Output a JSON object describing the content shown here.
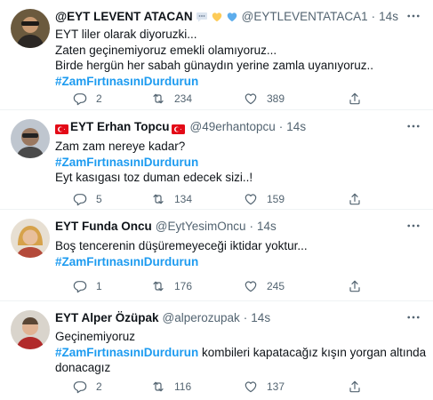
{
  "tweets": [
    {
      "name": "@EYT LEVENT ATACAN",
      "handle": "@EYTLEVENTATACA1",
      "dot": "·",
      "time": "14s",
      "lines": [
        "EYT liler olarak diyoruzki...",
        "Zaten geçinemiyoruz emekli olamıyoruz...",
        "Birde hergün her sabah günaydın yerine zamla uyanıyoruz.."
      ],
      "hashtag": "#ZamFırtınasınıDurdurun",
      "replies": "2",
      "retweets": "234",
      "likes": "389",
      "icons": [
        "speech-bubble-emoji-icon",
        "yellow-heart-emoji-icon",
        "blue-heart-emoji-icon"
      ]
    },
    {
      "name": "EYT Erhan Topcu",
      "handle": "@49erhantopcu",
      "dot": "·",
      "time": "14s",
      "line1": "Zam zam nereye kadar?",
      "hashtag": "#ZamFırtınasınıDurdurun",
      "line2": "Eyt kasıgası toz duman edecek sizi..!",
      "replies": "5",
      "retweets": "134",
      "likes": "159",
      "icons": [
        "turkey-flag-icon",
        "turkey-flag-icon"
      ]
    },
    {
      "name": "EYT Funda Oncu",
      "handle": "@EytYesimOncu",
      "dot": "·",
      "time": "14s",
      "line1": "Boş tencerenin düşüremeyeceği iktidar yoktur...",
      "hashtag": "#ZamFırtınasınıDurdurun",
      "replies": "1",
      "retweets": "176",
      "likes": "245"
    },
    {
      "name": "EYT Alper Özüpak",
      "handle": "@alperozupak",
      "dot": "·",
      "time": "14s",
      "line1": "Geçinemiyoruz",
      "hashtag": "#ZamFırtınasınıDurdurun",
      "after_hashtag": " kombileri kapatacağız kışın yorgan altında",
      "line3": "donacagız",
      "replies": "2",
      "retweets": "116",
      "likes": "137"
    }
  ],
  "colors": {
    "hashtag": "#1d9bf0",
    "secondary_text": "#536471",
    "divider": "#eff3f4"
  }
}
